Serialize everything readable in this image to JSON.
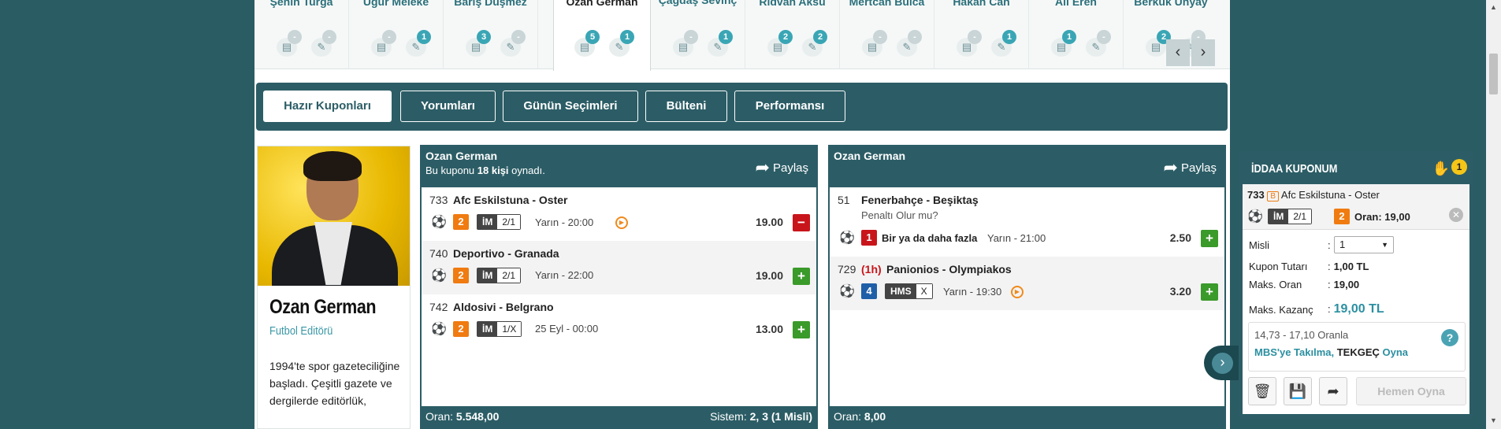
{
  "editors": [
    {
      "name": "Şenin Turga",
      "count1": "-",
      "count2": "-"
    },
    {
      "name": "Uğur Meleke",
      "count1": "-",
      "count2": "1"
    },
    {
      "name": "Barış Duşmez",
      "count1": "3",
      "count2": "-"
    },
    {
      "name": "Ozan German",
      "count1": "5",
      "count2": "1",
      "active": true
    },
    {
      "name": "Çağdaş Sevinç",
      "count1": "-",
      "count2": "1"
    },
    {
      "name": "Rıdvan Aksu",
      "count1": "2",
      "count2": "2"
    },
    {
      "name": "Mertcan Bulca",
      "count1": "-",
      "count2": "-"
    },
    {
      "name": "Hakan Can",
      "count1": "-",
      "count2": "1"
    },
    {
      "name": "Ali Eren",
      "count1": "1",
      "count2": "-"
    },
    {
      "name": "Berkuk Ünyay",
      "count1": "2",
      "count2": "-"
    }
  ],
  "nav": {
    "prev": "‹",
    "next": "›"
  },
  "tabs": [
    "Hazır Kuponları",
    "Yorumları",
    "Günün Seçimleri",
    "Bülteni",
    "Performansı"
  ],
  "profile": {
    "name": "Ozan German",
    "role": "Futbol Editörü",
    "bio": "1994'te spor gazeteciliğine başladı. Çeşitli gazete ve dergilerde editörlük,"
  },
  "coupon1": {
    "author": "Ozan German",
    "played_pre": "Bu kuponu ",
    "played_bold": "18 kişi",
    "played_post": " oynadı.",
    "share": "Paylaş",
    "rows": [
      {
        "num": "733",
        "match": "Afc Eskilstuna - Oster",
        "mbs": "2",
        "bet_key": "İM",
        "bet_val": "2/1",
        "time": "Yarın - 20:00",
        "odd": "19.00",
        "action": "−"
      },
      {
        "num": "740",
        "match": "Deportivo - Granada",
        "mbs": "2",
        "bet_key": "İM",
        "bet_val": "2/1",
        "time": "Yarın - 22:00",
        "odd": "19.00",
        "action": "+"
      },
      {
        "num": "742",
        "match": "Aldosivi - Belgrano",
        "mbs": "2",
        "bet_key": "İM",
        "bet_val": "1/X",
        "time": "25 Eyl - 00:00",
        "odd": "13.00",
        "action": "+"
      }
    ],
    "oran_label": "Oran: ",
    "oran": "5.548,00",
    "sistem_label": "Sistem: ",
    "sistem": "2, 3 (1 Misli)"
  },
  "coupon2": {
    "author": "Ozan German",
    "share": "Paylaş",
    "rows": [
      {
        "num": "51",
        "match": "Fenerbahçe - Beşiktaş",
        "sub": "Penaltı Olur mu?",
        "mbs": "1",
        "bet_text": "Bir ya da daha fazla",
        "time": "Yarın - 21:00",
        "odd": "2.50",
        "action": "+"
      },
      {
        "num": "729",
        "half": "(1h)",
        "match": "Panionios - Olympiakos",
        "mbs": "4",
        "bet_key": "HMS",
        "bet_val": "X",
        "time": "Yarın - 19:30",
        "odd": "3.20",
        "action": "+"
      }
    ],
    "oran_label": "Oran: ",
    "oran": "8,00"
  },
  "kupon": {
    "title": "İDDAA KUPONUM",
    "count": "1",
    "sel_num": "733",
    "sel_tag": "B",
    "sel_match": "Afc Eskilstuna - Oster",
    "sel_bet_key": "İM",
    "sel_bet_val": "2/1",
    "sel_mbs": "2",
    "sel_oran": "Oran: 19,00",
    "misli_label": "Misli",
    "misli": "1",
    "tutar_label": "Kupon Tutarı",
    "tutar": "1,00 TL",
    "oran_label": "Maks. Oran",
    "oran": "19,00",
    "kazanc_label": "Maks. Kazanç",
    "kazanc": "19,00 TL",
    "info_range": "14,73 - 17,10 Oranla",
    "info_mbs": "MBS'ye Takılma, ",
    "info_tekgec": "TEKGEÇ",
    "info_oyna": " Oyna",
    "play": "Hemen Oyna"
  },
  "colors": {
    "primary": "#2c5d66",
    "accent": "#3aa6b5",
    "plus": "#3a9a2a",
    "minus": "#c8151b",
    "mbs_orange": "#f07b10"
  }
}
